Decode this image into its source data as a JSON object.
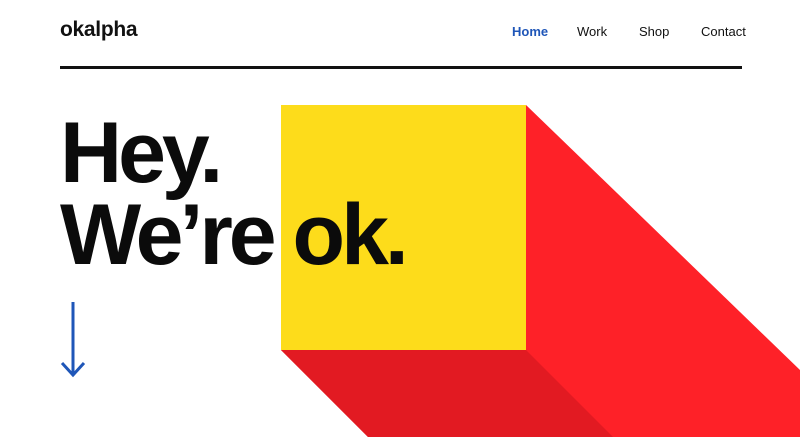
{
  "header": {
    "logo": "okalpha",
    "nav": [
      {
        "label": "Home",
        "active": true
      },
      {
        "label": "Work",
        "active": false
      },
      {
        "label": "Shop",
        "active": false
      },
      {
        "label": "Contact",
        "active": false
      }
    ]
  },
  "hero": {
    "line1": "Hey.",
    "line2": "We’re ok."
  },
  "colors": {
    "nav_active": "#1f56b8",
    "yellow": "#fddc1b",
    "red": "#fe2128",
    "dark_red": "#e21a22",
    "arrow": "#1f56b8"
  },
  "icons": {
    "scroll": "arrow-down-icon"
  }
}
